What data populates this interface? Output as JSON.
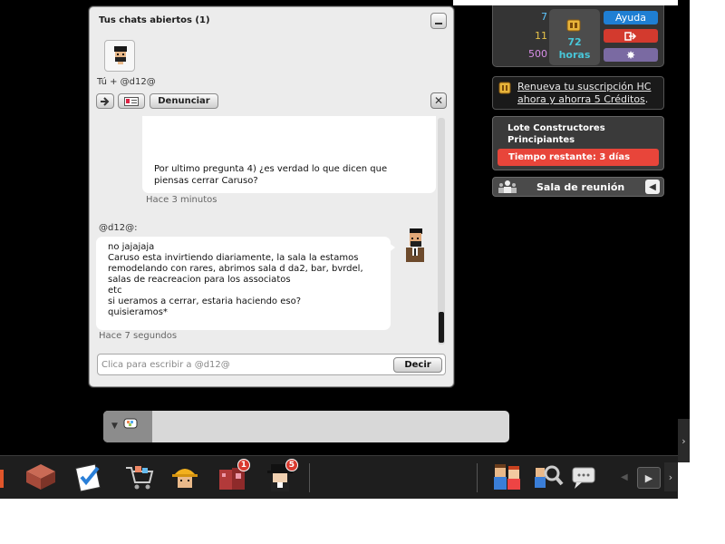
{
  "chat": {
    "title": "Tus chats abiertos (1)",
    "participants": "Tú + @d12@",
    "report_label": "Denunciar",
    "messages": [
      {
        "lines": [
          "Por ultimo pregunta 4) ¿es verdad lo que dicen que",
          "piensas cerrar Caruso?"
        ],
        "time": "Hace 3 minutos"
      },
      {
        "sender": "@d12@:",
        "lines": [
          "no jajajaja",
          "Caruso esta invirtiendo diariamente, la sala la estamos",
          "remodelando con rares, abrimos sala d da2, bar, bvrdel,",
          "salas de reacreacion para los associatos",
          "etc",
          "si ueramos a cerrar, estaria haciendo eso?",
          "quisieramos*"
        ],
        "time": "Hace 7 segundos"
      }
    ],
    "input_placeholder": "Clica para escribir a @d12@",
    "send_label": "Decir"
  },
  "hud": {
    "diamonds": "7",
    "credits": "11",
    "duckets": "500",
    "hc_hours": "72",
    "hc_unit": "horas",
    "help_label": "Ayuda",
    "promo_text": "Renueva tu suscripción HC ahora y ahorra 5 Créditos",
    "promo_suffix": ".",
    "builders_title_1": "Lote Constructores",
    "builders_title_2": "Principiantes",
    "builders_timer": "Tiempo restante: 3 días",
    "room_label": "Sala de reunión"
  },
  "toolbar": {
    "catalog_badge": "1",
    "messenger_badge": "5"
  },
  "colors": {
    "game_background": "#000000",
    "help_button": "#1f7fd3",
    "logout_button": "#d33a2e",
    "settings_button": "#7a6aa2",
    "timer_bar": "#e8453a",
    "hc_hours_text": "#48c6d8",
    "badge": "#d83a2f"
  },
  "icons": {
    "diamonds": "diamond-icon",
    "credits": "credit-coin-icon",
    "duckets": "ducket-icon",
    "hc": "hc-club-icon",
    "logout": "logout-icon",
    "settings": "gear-icon",
    "room_people": "room-people-icon",
    "promo": "hc-promo-icon",
    "toolbar": [
      "home-icon",
      "rooms-icon",
      "quests-icon",
      "shop-cart-icon",
      "builder-icon",
      "catalog-icon",
      "messenger-icon",
      "friends-icon",
      "search-friends-icon",
      "chat-bubble-icon"
    ]
  }
}
